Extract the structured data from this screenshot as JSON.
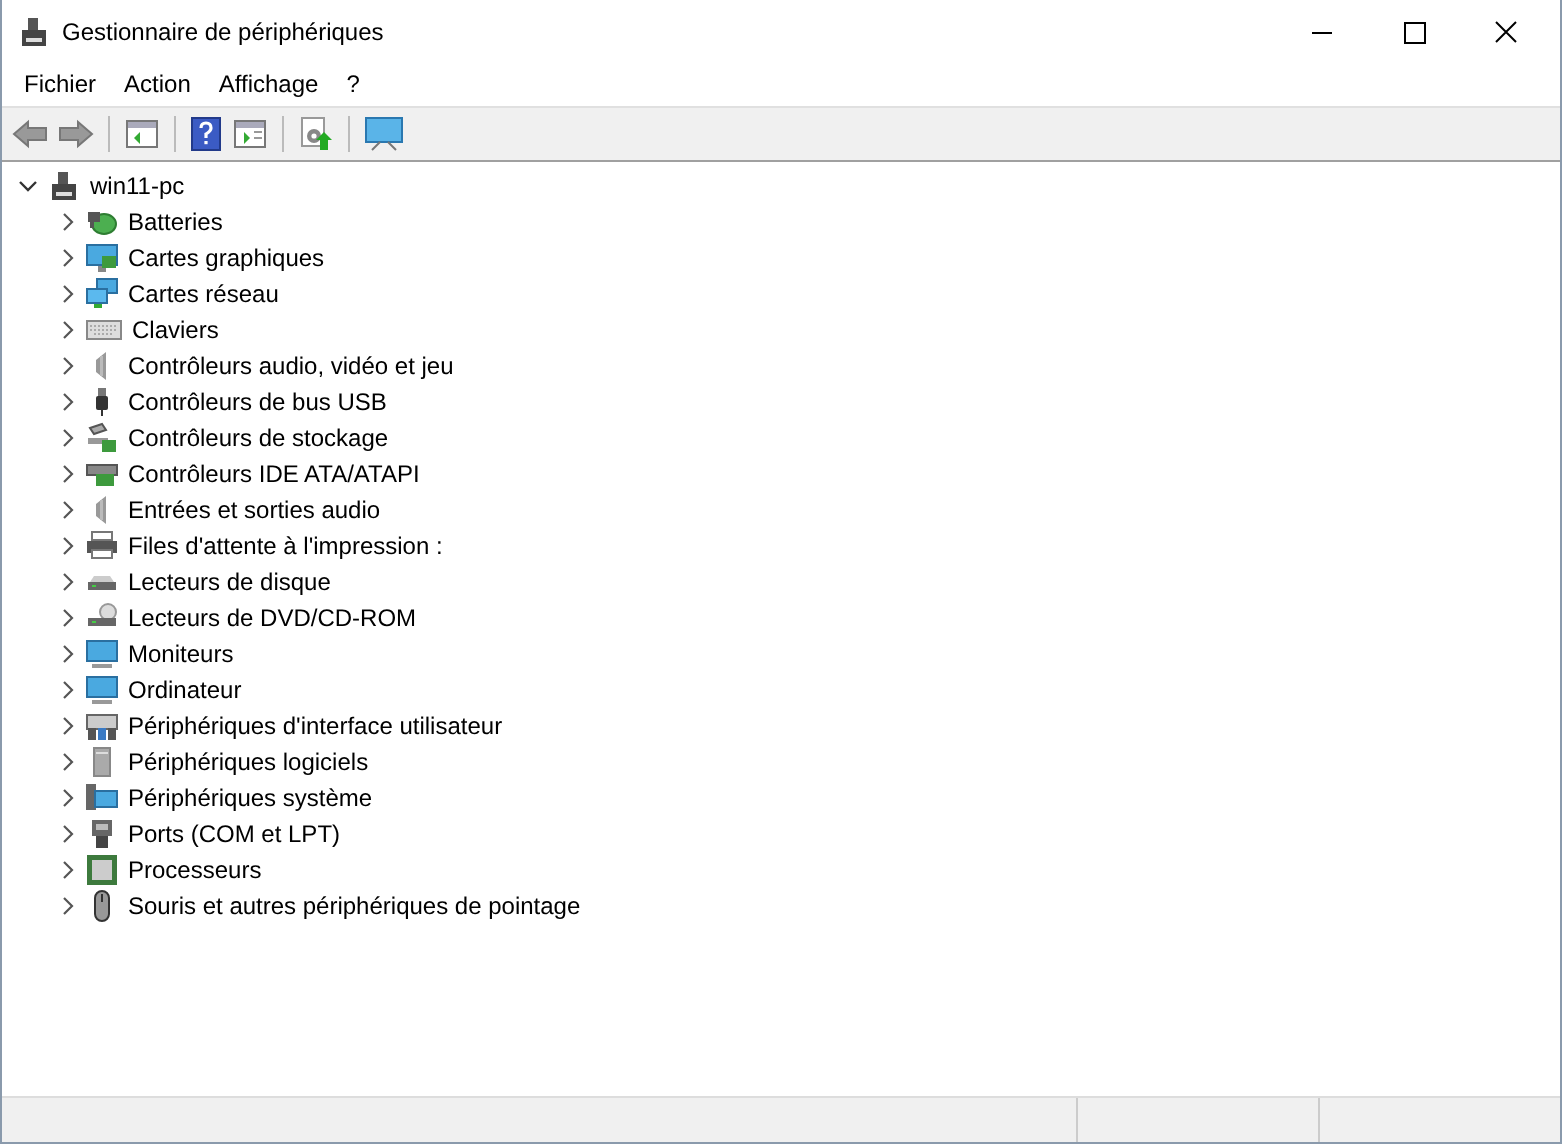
{
  "window": {
    "title": "Gestionnaire de périphériques"
  },
  "menu": [
    "Fichier",
    "Action",
    "Affichage",
    "?"
  ],
  "tree": {
    "label": "win11-pc",
    "expanded": true,
    "children": [
      {
        "label": "Batteries",
        "expanded": false
      },
      {
        "label": "Cartes graphiques",
        "expanded": false
      },
      {
        "label": "Cartes réseau",
        "expanded": false
      },
      {
        "label": "Claviers",
        "expanded": false
      },
      {
        "label": "Contrôleurs audio, vidéo et jeu",
        "expanded": false
      },
      {
        "label": "Contrôleurs de bus USB",
        "expanded": false
      },
      {
        "label": "Contrôleurs de stockage",
        "expanded": false
      },
      {
        "label": "Contrôleurs IDE ATA/ATAPI",
        "expanded": false
      },
      {
        "label": "Entrées et sorties audio",
        "expanded": false
      },
      {
        "label": "Files d'attente à l'impression :",
        "expanded": false
      },
      {
        "label": "Lecteurs de disque",
        "expanded": false
      },
      {
        "label": "Lecteurs de DVD/CD-ROM",
        "expanded": false
      },
      {
        "label": "Moniteurs",
        "expanded": false
      },
      {
        "label": "Ordinateur",
        "expanded": false
      },
      {
        "label": "Périphériques d'interface utilisateur",
        "expanded": false
      },
      {
        "label": "Périphériques logiciels",
        "expanded": false
      },
      {
        "label": "Périphériques système",
        "expanded": false
      },
      {
        "label": "Ports (COM et LPT)",
        "expanded": false
      },
      {
        "label": "Processeurs",
        "expanded": false
      },
      {
        "label": "Souris et autres périphériques de pointage",
        "expanded": false
      }
    ]
  }
}
